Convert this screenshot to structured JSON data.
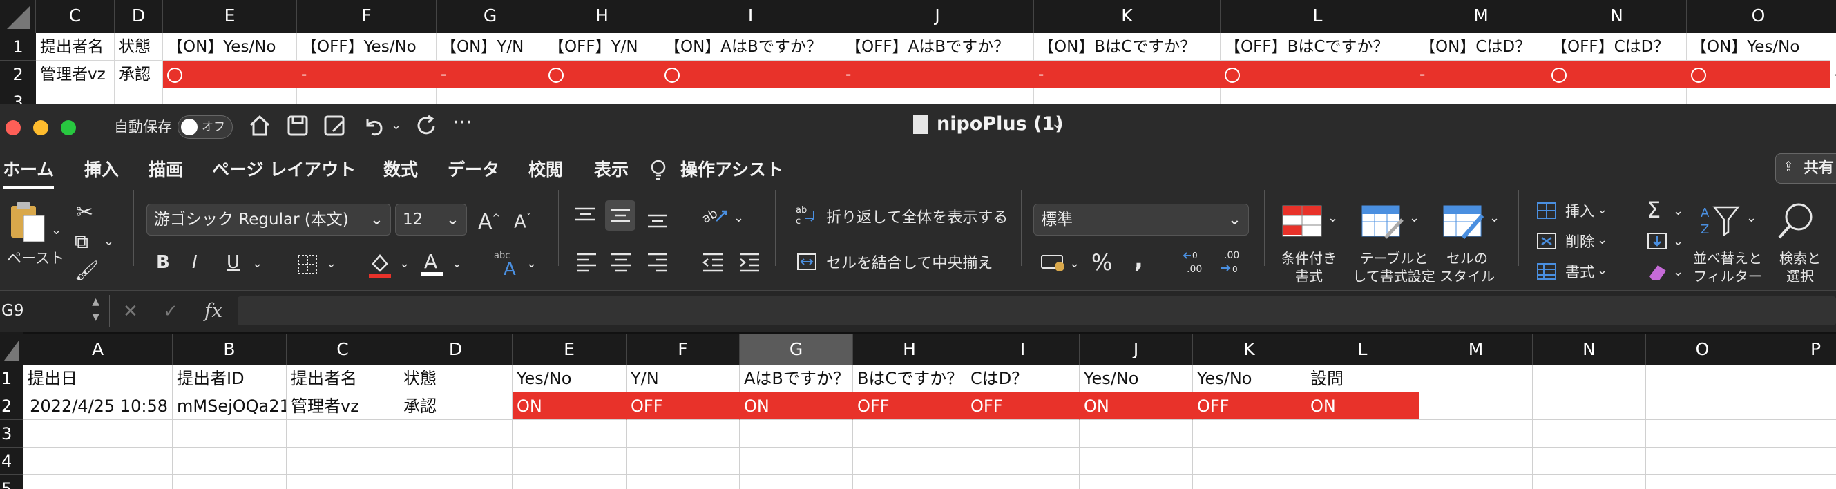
{
  "top_sheet": {
    "columns": [
      "C",
      "D",
      "E",
      "F",
      "G",
      "H",
      "I",
      "J",
      "K",
      "L",
      "M",
      "N",
      "O"
    ],
    "rows": [
      "1",
      "2",
      "3"
    ],
    "header_row": [
      "提出者名",
      "状態",
      "【ON】Yes/No",
      "【OFF】Yes/No",
      "【ON】Y/N",
      "【OFF】Y/N",
      "【ON】AはBですか？",
      "【OFF】AはBですか？",
      "【ON】BはCですか？",
      "【OFF】BはCですか？",
      "【ON】CはD？",
      "【OFF】CはD？",
      "【ON】Yes/No"
    ],
    "data_row": [
      "管理者vz",
      "承認",
      "○",
      "-",
      "-",
      "○",
      "○",
      "-",
      "-",
      "○",
      "-",
      "○",
      "○"
    ],
    "overflow_dash": "-"
  },
  "window": {
    "autosave_label": "自動保存",
    "autosave_state": "オフ",
    "doc_title": "nipoPlus (1)",
    "tabs": [
      "ホーム",
      "挿入",
      "描画",
      "ページ レイアウト",
      "数式",
      "データ",
      "校閲",
      "表示"
    ],
    "assist_label": "操作アシスト",
    "share_label": "共有",
    "font_name": "游ゴシック Regular (本文)",
    "font_size": "12",
    "paste_label": "ペースト",
    "wrap_label": "折り返して全体を表示する",
    "merge_label": "セルを結合して中央揃え",
    "number_format": "標準",
    "cond_format_label1": "条件付き",
    "cond_format_label2": "書式",
    "table_format_label1": "テーブルと",
    "table_format_label2": "して書式設定",
    "cell_style_label1": "セルの",
    "cell_style_label2": "スタイル",
    "insert_label": "挿入",
    "delete_label": "削除",
    "format_label": "書式",
    "sort_label1": "並べ替えと",
    "sort_label2": "フィルター",
    "find_label1": "検索と",
    "find_label2": "選択",
    "name_box": "G9",
    "fx": "fx"
  },
  "bottom_sheet": {
    "columns": [
      "A",
      "B",
      "C",
      "D",
      "E",
      "F",
      "G",
      "H",
      "I",
      "J",
      "K",
      "L",
      "M",
      "N",
      "O",
      "P"
    ],
    "rows": [
      "1",
      "2",
      "3",
      "4",
      "5"
    ],
    "header_row": [
      "提出日",
      "提出者ID",
      "提出者名",
      "状態",
      "Yes/No",
      "Y/N",
      "AはBですか？",
      "BはCですか？",
      "CはD？",
      "Yes/No",
      "Yes/No",
      "設問"
    ],
    "data_row": [
      "2022/4/25 10:58",
      "mMSejOQa21",
      "管理者vz",
      "承認",
      "ON",
      "OFF",
      "ON",
      "OFF",
      "OFF",
      "ON",
      "OFF",
      "ON"
    ]
  },
  "colors": {
    "accent_red": "#e8322a",
    "dark_bg": "#2b2b2b"
  }
}
